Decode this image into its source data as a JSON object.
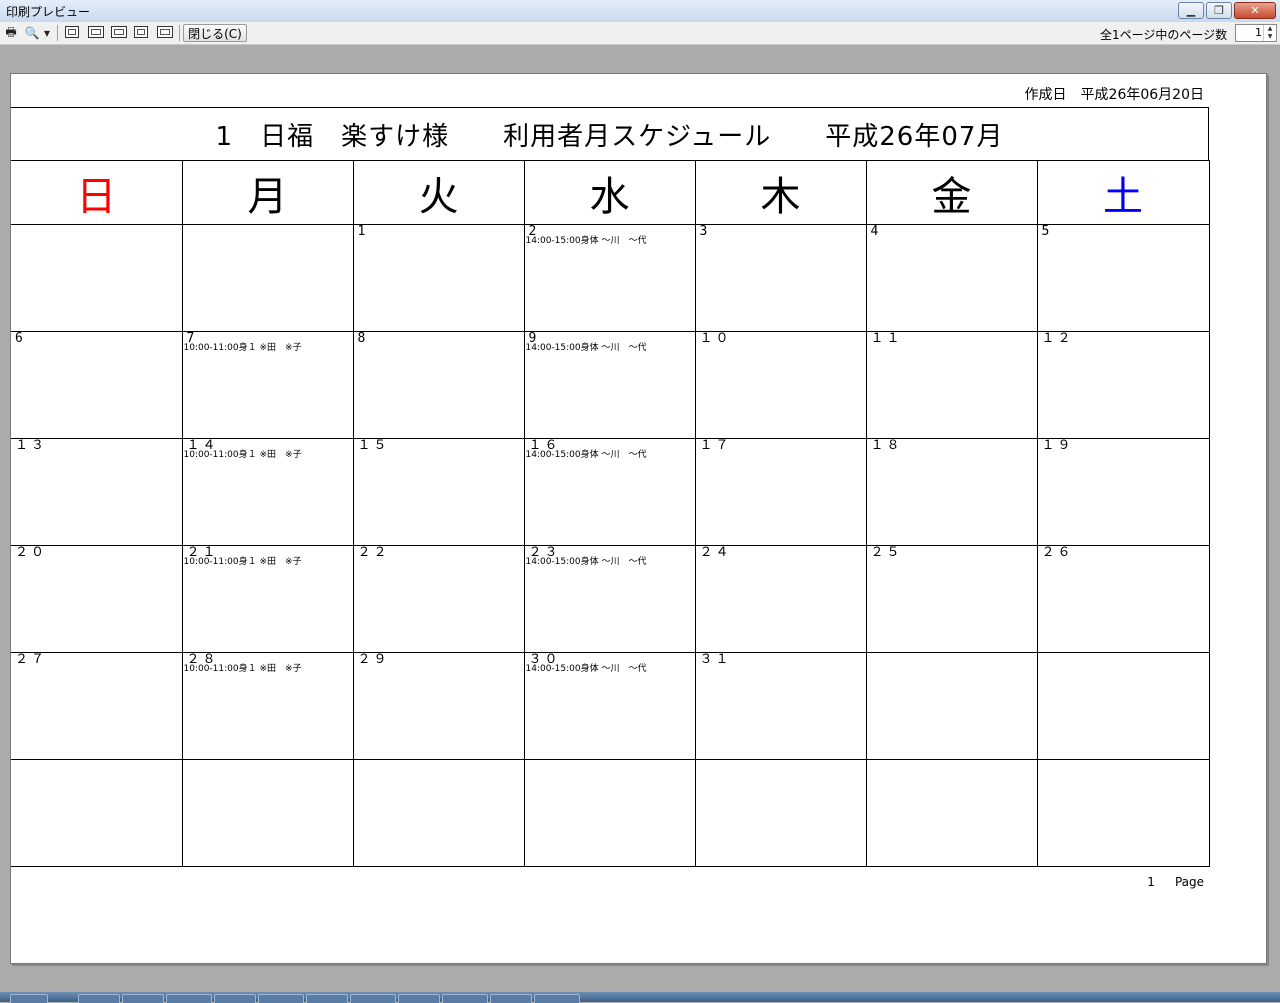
{
  "window": {
    "title": "印刷プレビュー",
    "minimize_label": "▁",
    "restore_label": "❐",
    "close_label": "✕"
  },
  "toolbar": {
    "print_icon": "🖶",
    "zoom_icon": "🔍",
    "dropdown_icon": "▾",
    "close_label": "閉じる(C)",
    "page_count_label": "全1ページ中のページ数",
    "page_value": "1"
  },
  "document": {
    "created": "作成日　平成26年06月20日",
    "title": "1　日福　楽すけ様　　利用者月スケジュール　　平成26年07月",
    "weekdays": [
      {
        "label": "日",
        "color": "#ff0000"
      },
      {
        "label": "月",
        "color": "#000000"
      },
      {
        "label": "火",
        "color": "#000000"
      },
      {
        "label": "水",
        "color": "#000000"
      },
      {
        "label": "木",
        "color": "#000000"
      },
      {
        "label": "金",
        "color": "#000000"
      },
      {
        "label": "土",
        "color": "#0000ff"
      }
    ],
    "weeks": [
      [
        {
          "day": "",
          "event": ""
        },
        {
          "day": "",
          "event": ""
        },
        {
          "day": "1",
          "event": ""
        },
        {
          "day": "2",
          "event": "14:00-15:00身体 〜川　〜代"
        },
        {
          "day": "3",
          "event": ""
        },
        {
          "day": "4",
          "event": ""
        },
        {
          "day": "5",
          "event": ""
        }
      ],
      [
        {
          "day": "6",
          "event": ""
        },
        {
          "day": "7",
          "event": "10:00-11:00身１ ※田　※子"
        },
        {
          "day": "8",
          "event": ""
        },
        {
          "day": "9",
          "event": "14:00-15:00身体 〜川　〜代"
        },
        {
          "day": "１０",
          "event": ""
        },
        {
          "day": "１１",
          "event": ""
        },
        {
          "day": "１２",
          "event": ""
        }
      ],
      [
        {
          "day": "１３",
          "event": ""
        },
        {
          "day": "１４",
          "event": "10:00-11:00身１ ※田　※子"
        },
        {
          "day": "１５",
          "event": ""
        },
        {
          "day": "１６",
          "event": "14:00-15:00身体 〜川　〜代"
        },
        {
          "day": "１７",
          "event": ""
        },
        {
          "day": "１８",
          "event": ""
        },
        {
          "day": "１９",
          "event": ""
        }
      ],
      [
        {
          "day": "２０",
          "event": ""
        },
        {
          "day": "２１",
          "event": "10:00-11:00身１ ※田　※子"
        },
        {
          "day": "２２",
          "event": ""
        },
        {
          "day": "２３",
          "event": "14:00-15:00身体 〜川　〜代"
        },
        {
          "day": "２４",
          "event": ""
        },
        {
          "day": "２５",
          "event": ""
        },
        {
          "day": "２６",
          "event": ""
        }
      ],
      [
        {
          "day": "２７",
          "event": ""
        },
        {
          "day": "２８",
          "event": "10:00-11:00身１ ※田　※子"
        },
        {
          "day": "２９",
          "event": ""
        },
        {
          "day": "３０",
          "event": "14:00-15:00身体 〜川　〜代"
        },
        {
          "day": "３１",
          "event": ""
        },
        {
          "day": "",
          "event": ""
        },
        {
          "day": "",
          "event": ""
        }
      ],
      [
        {
          "day": "",
          "event": ""
        },
        {
          "day": "",
          "event": ""
        },
        {
          "day": "",
          "event": ""
        },
        {
          "day": "",
          "event": ""
        },
        {
          "day": "",
          "event": ""
        },
        {
          "day": "",
          "event": ""
        },
        {
          "day": "",
          "event": ""
        }
      ]
    ],
    "footer_page": "1",
    "footer_label": "Page"
  }
}
